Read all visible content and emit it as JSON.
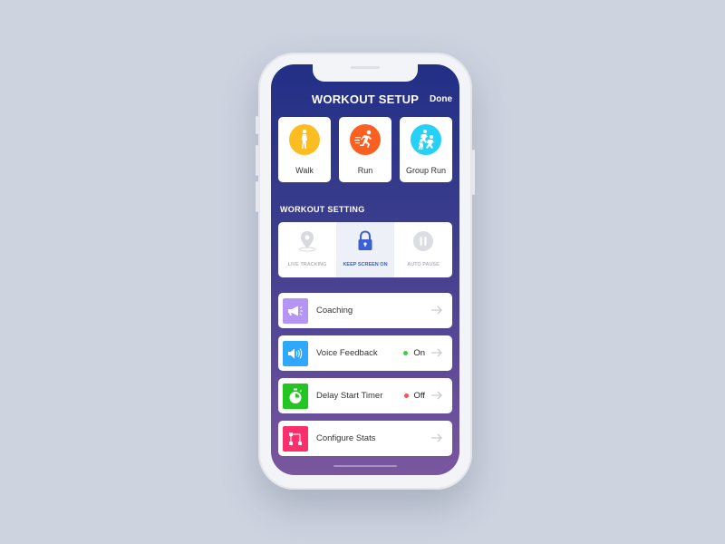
{
  "header": {
    "title": "WORKOUT SETUP",
    "done_label": "Done"
  },
  "workout_types": [
    {
      "label": "Walk",
      "icon": "walk-icon",
      "color": "#fbbd22"
    },
    {
      "label": "Run",
      "icon": "run-icon",
      "color": "#fb5f22"
    },
    {
      "label": "Group Run",
      "icon": "group-run-icon",
      "color": "#27d0f5"
    }
  ],
  "settings": {
    "section_label": "WORKOUT SETTING",
    "toggles": [
      {
        "label": "LIVE TRACKING",
        "icon": "location-pin-icon",
        "active": false
      },
      {
        "label": "KEEP SCREEN ON",
        "icon": "lock-icon",
        "active": true
      },
      {
        "label": "AUTO PAUSE",
        "icon": "pause-icon",
        "active": false
      }
    ]
  },
  "options": [
    {
      "label": "Coaching",
      "icon": "megaphone-icon",
      "color": "#b595f3",
      "status": null
    },
    {
      "label": "Voice Feedback",
      "icon": "speaker-icon",
      "color": "#2fa8fb",
      "status": "On",
      "status_color": "#3bd33b"
    },
    {
      "label": "Delay Start Timer",
      "icon": "stopwatch-icon",
      "color": "#22c522",
      "status": "Off",
      "status_color": "#f25454"
    },
    {
      "label": "Configure Stats",
      "icon": "flowchart-icon",
      "color": "#fb2f6c",
      "status": null
    }
  ],
  "colors": {
    "accent": "#3a5fd6",
    "header_gradient_top": "#222f86",
    "header_gradient_bottom": "#7a579f"
  }
}
